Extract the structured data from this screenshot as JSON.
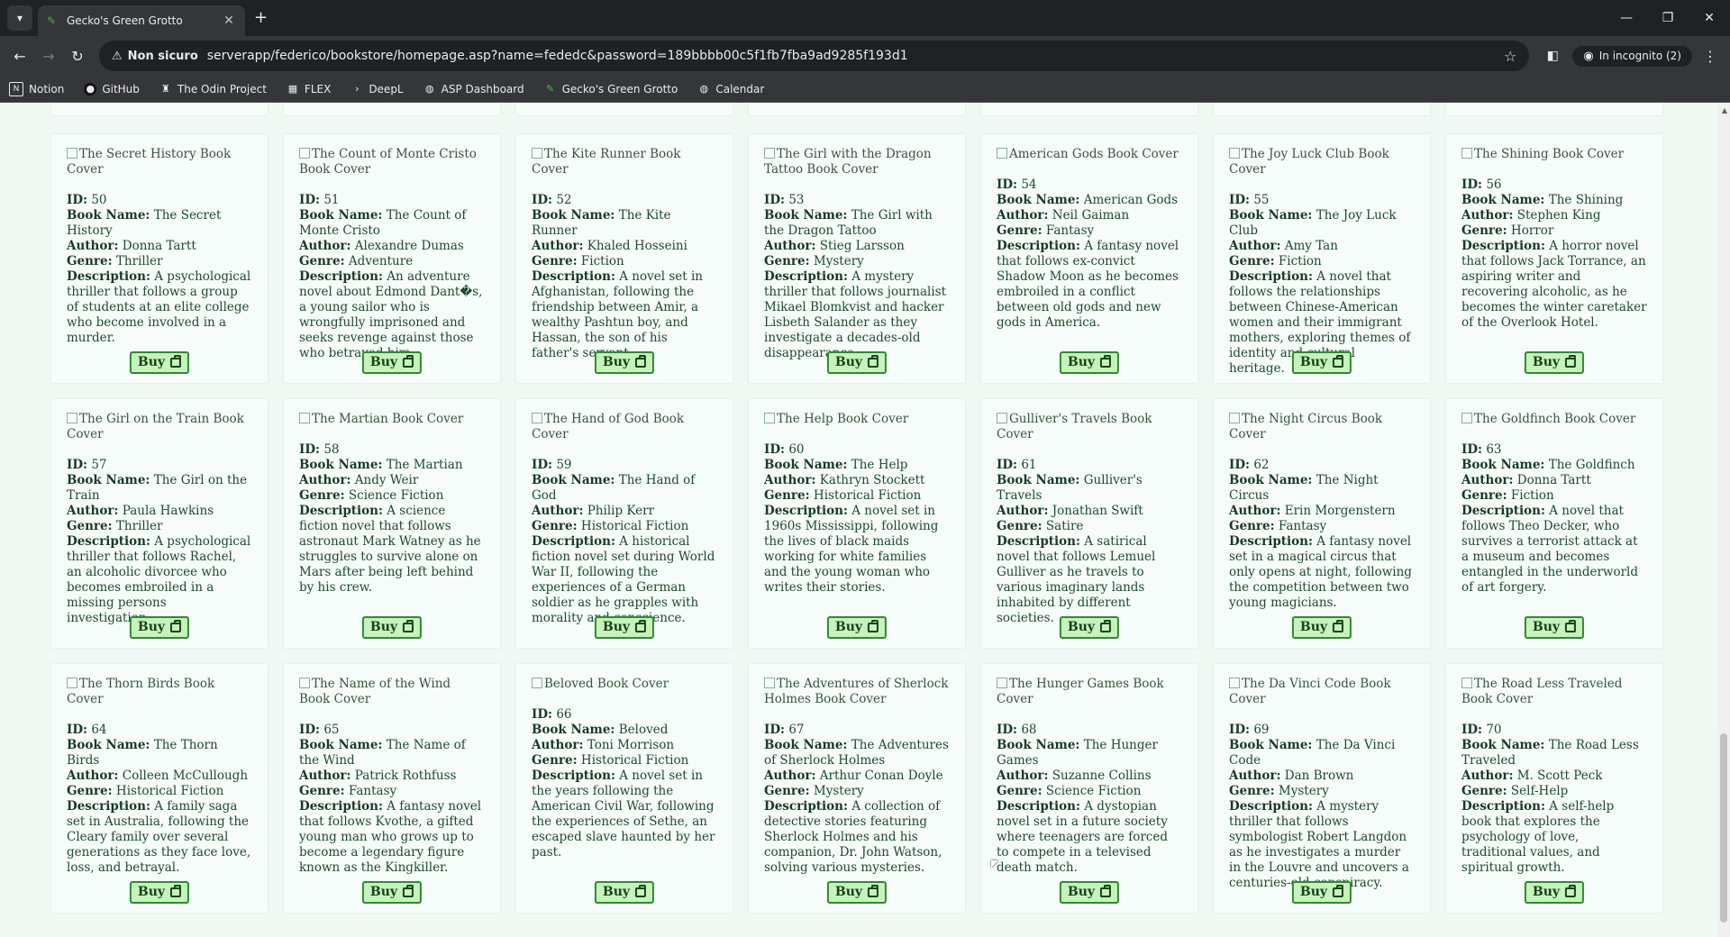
{
  "browser": {
    "tab_title": "Gecko's Green Grotto",
    "not_secure": "Non sicuro",
    "url": "serverapp/federico/bookstore/homepage.asp?name=fededc&password=189bbbb00c5f1fb7fba9ad9285f193d1",
    "incognito": "In incognito (2)"
  },
  "bookmarks": [
    "Notion",
    "GitHub",
    "The Odin Project",
    "FLEX",
    "DeepL",
    "ASP Dashboard",
    "Gecko's Green Grotto",
    "Calendar"
  ],
  "labels": {
    "id": "ID:",
    "name": "Book Name:",
    "author": "Author:",
    "genre": "Genre:",
    "description": "Description:",
    "buy": "Buy"
  },
  "books": [
    {
      "cover": "The Secret History Book Cover",
      "id": "50",
      "name": "The Secret History",
      "author": "Donna Tartt",
      "genre": "Thriller",
      "description": "A psychological thriller that follows a group of students at an elite college who become involved in a murder."
    },
    {
      "cover": "The Count of Monte Cristo Book Cover",
      "id": "51",
      "name": "The Count of Monte Cristo",
      "author": "Alexandre Dumas",
      "genre": "Adventure",
      "description": "An adventure novel about Edmond Dant�s, a young sailor who is wrongfully imprisoned and seeks revenge against those who betrayed him."
    },
    {
      "cover": "The Kite Runner Book Cover",
      "id": "52",
      "name": "The Kite Runner",
      "author": "Khaled Hosseini",
      "genre": "Fiction",
      "description": "A novel set in Afghanistan, following the friendship between Amir, a wealthy Pashtun boy, and Hassan, the son of his father's servant."
    },
    {
      "cover": "The Girl with the Dragon Tattoo Book Cover",
      "id": "53",
      "name": "The Girl with the Dragon Tattoo",
      "author": "Stieg Larsson",
      "genre": "Mystery",
      "description": "A mystery thriller that follows journalist Mikael Blomkvist and hacker Lisbeth Salander as they investigate a decades-old disappearance."
    },
    {
      "cover": "American Gods Book Cover",
      "id": "54",
      "name": "American Gods",
      "author": "Neil Gaiman",
      "genre": "Fantasy",
      "description": "A fantasy novel that follows ex-convict Shadow Moon as he becomes embroiled in a conflict between old gods and new gods in America."
    },
    {
      "cover": "The Joy Luck Club Book Cover",
      "id": "55",
      "name": "The Joy Luck Club",
      "author": "Amy Tan",
      "genre": "Fiction",
      "description": "A novel that follows the relationships between Chinese-American women and their immigrant mothers, exploring themes of identity and cultural heritage."
    },
    {
      "cover": "The Shining Book Cover",
      "id": "56",
      "name": "The Shining",
      "author": "Stephen King",
      "genre": "Horror",
      "description": "A horror novel that follows Jack Torrance, an aspiring writer and recovering alcoholic, as he becomes the winter caretaker of the Overlook Hotel."
    },
    {
      "cover": "The Girl on the Train Book Cover",
      "id": "57",
      "name": "The Girl on the Train",
      "author": "Paula Hawkins",
      "genre": "Thriller",
      "description": "A psychological thriller that follows Rachel, an alcoholic divorcee who becomes embroiled in a missing persons investigation."
    },
    {
      "cover": "The Martian Book Cover",
      "id": "58",
      "name": "The Martian",
      "author": "Andy Weir",
      "genre": "Science Fiction",
      "description": "A science fiction novel that follows astronaut Mark Watney as he struggles to survive alone on Mars after being left behind by his crew."
    },
    {
      "cover": "The Hand of God Book Cover",
      "id": "59",
      "name": "The Hand of God",
      "author": "Philip Kerr",
      "genre": "Historical Fiction",
      "description": "A historical fiction novel set during World War II, following the experiences of a German soldier as he grapples with morality and conscience."
    },
    {
      "cover": "The Help Book Cover",
      "id": "60",
      "name": "The Help",
      "author": "Kathryn Stockett",
      "genre": "Historical Fiction",
      "description": "A novel set in 1960s Mississippi, following the lives of black maids working for white families and the young woman who writes their stories."
    },
    {
      "cover": "Gulliver's Travels Book Cover",
      "id": "61",
      "name": "Gulliver's Travels",
      "author": "Jonathan Swift",
      "genre": "Satire",
      "description": "A satirical novel that follows Lemuel Gulliver as he travels to various imaginary lands inhabited by different societies."
    },
    {
      "cover": "The Night Circus Book Cover",
      "id": "62",
      "name": "The Night Circus",
      "author": "Erin Morgenstern",
      "genre": "Fantasy",
      "description": "A fantasy novel set in a magical circus that only opens at night, following the competition between two young magicians."
    },
    {
      "cover": "The Goldfinch Book Cover",
      "id": "63",
      "name": "The Goldfinch",
      "author": "Donna Tartt",
      "genre": "Fiction",
      "description": "A novel that follows Theo Decker, who survives a terrorist attack at a museum and becomes entangled in the underworld of art forgery."
    },
    {
      "cover": "The Thorn Birds Book Cover",
      "id": "64",
      "name": "The Thorn Birds",
      "author": "Colleen McCullough",
      "genre": "Historical Fiction",
      "description": "A family saga set in Australia, following the Cleary family over several generations as they face love, loss, and betrayal."
    },
    {
      "cover": "The Name of the Wind Book Cover",
      "id": "65",
      "name": "The Name of the Wind",
      "author": "Patrick Rothfuss",
      "genre": "Fantasy",
      "description": "A fantasy novel that follows Kvothe, a gifted young man who grows up to become a legendary figure known as the Kingkiller."
    },
    {
      "cover": "Beloved Book Cover",
      "id": "66",
      "name": "Beloved",
      "author": "Toni Morrison",
      "genre": "Historical Fiction",
      "description": "A novel set in the years following the American Civil War, following the experiences of Sethe, an escaped slave haunted by her past."
    },
    {
      "cover": "The Adventures of Sherlock Holmes Book Cover",
      "id": "67",
      "name": "The Adventures of Sherlock Holmes",
      "author": "Arthur Conan Doyle",
      "genre": "Mystery",
      "description": "A collection of detective stories featuring Sherlock Holmes and his companion, Dr. John Watson, solving various mysteries."
    },
    {
      "cover": "The Hunger Games Book Cover",
      "id": "68",
      "name": "The Hunger Games",
      "author": "Suzanne Collins",
      "genre": "Science Fiction",
      "description": "A dystopian novel set in a future society where teenagers are forced to compete in a televised death match."
    },
    {
      "cover": "The Da Vinci Code Book Cover",
      "id": "69",
      "name": "The Da Vinci Code",
      "author": "Dan Brown",
      "genre": "Mystery",
      "description": "A mystery thriller that follows symbologist Robert Langdon as he investigates a murder in the Louvre and uncovers a centuries-old conspiracy."
    },
    {
      "cover": "The Road Less Traveled Book Cover",
      "id": "70",
      "name": "The Road Less Traveled",
      "author": "M. Scott Peck",
      "genre": "Self-Help",
      "description": "A self-help book that explores the psychology of love, traditional values, and spiritual growth."
    }
  ]
}
